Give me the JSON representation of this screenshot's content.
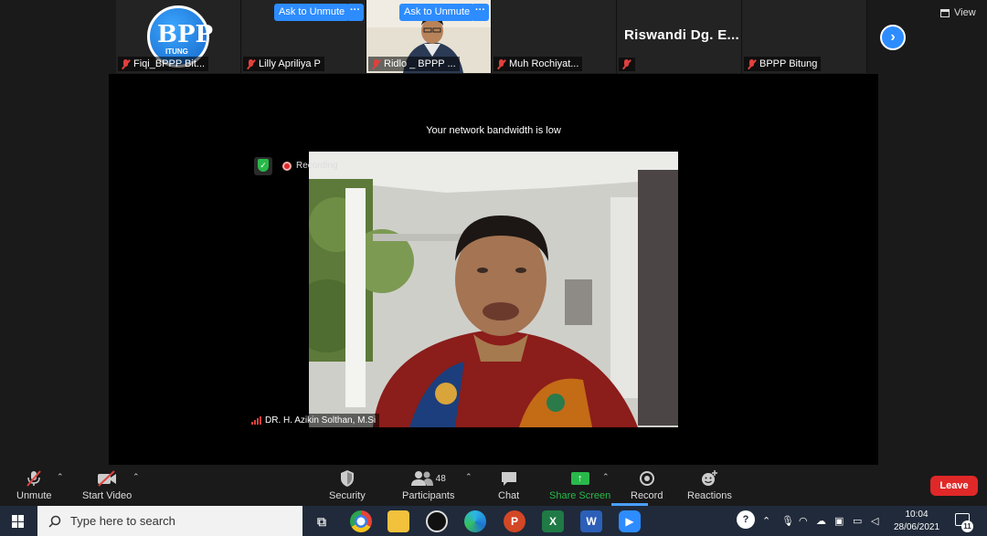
{
  "gallery": {
    "tiles": [
      {
        "name": "Fiqi_BPPP Bit...",
        "logo_text": "BPP",
        "logo_sub": "ITUNG"
      },
      {
        "name": "Lilly Apriliya P",
        "ask_label": "Ask to Unmute",
        "more_label": "···"
      },
      {
        "name": "Ridlo _ BPPP ...",
        "ask_label": "Ask to Unmute",
        "more_label": "···"
      },
      {
        "name": "Muh Rochiyat..."
      },
      {
        "name": "",
        "big_name": "Riswandi Dg. E..."
      },
      {
        "name": "BPPP Bitung"
      }
    ],
    "next_icon": "chevron-right-icon",
    "view_label": "View"
  },
  "stage": {
    "notice": "Your network bandwidth is low",
    "recording_label": "Recording",
    "speaker_name": "DR. H. Azikin Solthan, M.Si"
  },
  "toolbar": {
    "unmute": "Unmute",
    "start_video": "Start Video",
    "security": "Security",
    "participants": "Participants",
    "participants_count": "48",
    "chat": "Chat",
    "share_screen": "Share Screen",
    "record": "Record",
    "reactions": "Reactions",
    "leave": "Leave"
  },
  "taskbar": {
    "search_placeholder": "Type here to search",
    "time": "10:04",
    "date": "28/06/2021",
    "notification_count": "11"
  },
  "colors": {
    "accent": "#2d8cff",
    "leave": "#e02828",
    "share": "#29b94a",
    "muted": "#e0413d"
  }
}
